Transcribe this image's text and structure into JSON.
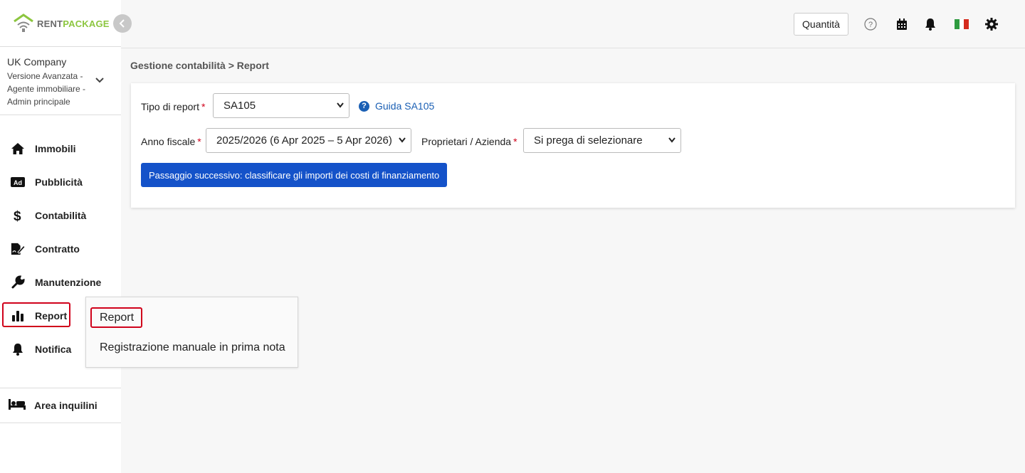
{
  "brand": {
    "part1": "RENT",
    "part2": "PACKAGE",
    "color_green": "#8cc63f"
  },
  "company": {
    "name": "UK Company",
    "subtitle": "Versione Avanzata - Agente immobiliare - Admin principale"
  },
  "nav": {
    "items": [
      {
        "label": "Immobili",
        "icon": "home-icon"
      },
      {
        "label": "Pubblicità",
        "icon": "ad-icon"
      },
      {
        "label": "Contabilità",
        "icon": "dollar-icon"
      },
      {
        "label": "Contratto",
        "icon": "contract-icon"
      },
      {
        "label": "Manutenzione",
        "icon": "wrench-icon"
      },
      {
        "label": "Report",
        "icon": "bar-chart-icon"
      },
      {
        "label": "Notifica",
        "icon": "bell-icon"
      }
    ],
    "tenant_area": {
      "label": "Area inquilini",
      "icon": "bed-icon"
    }
  },
  "topbar": {
    "quantity_label": "Quantità",
    "icons": [
      "help-icon",
      "calendar-icon",
      "bell-icon",
      "italy-flag-icon",
      "gear-icon"
    ]
  },
  "breadcrumb": {
    "parent": "Gestione contabilità",
    "separator": ">",
    "current": "Report"
  },
  "form": {
    "report_type": {
      "label": "Tipo di report",
      "value": "SA105"
    },
    "guide_link": "Guida SA105",
    "fiscal_year": {
      "label": "Anno fiscale",
      "value": "2025/2026 (6 Apr 2025 – 5 Apr 2026)"
    },
    "owners": {
      "label": "Proprietari / Azienda",
      "value": "Si prega di selezionare"
    },
    "required_mark": "*",
    "next_button": "Passaggio successivo: classificare gli importi dei costi di finanziamento"
  },
  "flyout": {
    "items": [
      "Report",
      "Registrazione manuale in prima nota"
    ]
  },
  "colors": {
    "primary": "#1452c9",
    "link": "#1a5fb4",
    "highlight": "#d0021b"
  }
}
